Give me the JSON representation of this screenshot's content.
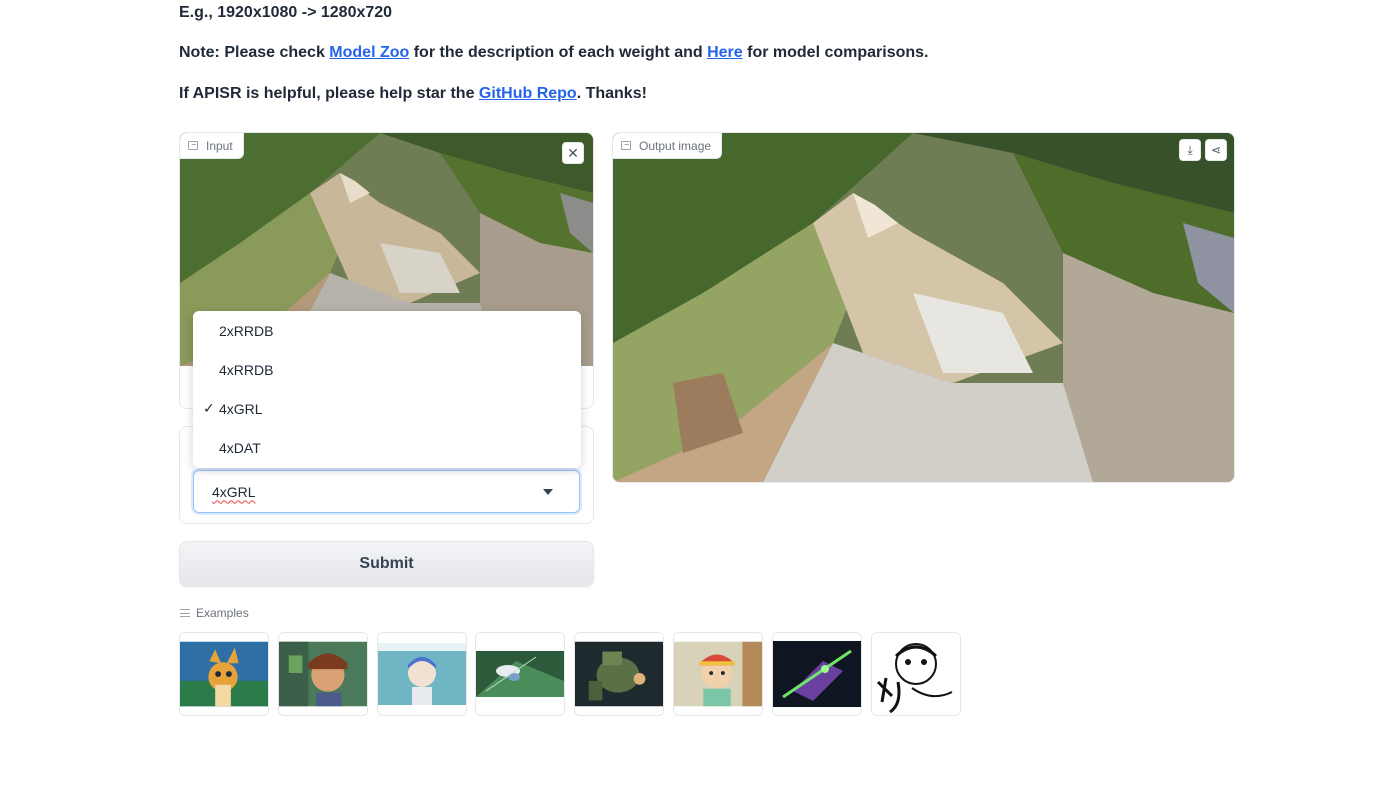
{
  "intro": {
    "line1": "E.g., 1920x1080 -> 1280x720",
    "line2_pre": "Note: Please check ",
    "line2_link1": "Model Zoo",
    "line2_mid": " for the description of each weight and ",
    "line2_link2": "Here",
    "line2_post": " for model comparisons.",
    "line3_pre": "If APISR is helpful, please help star the ",
    "line3_link": "GitHub Repo",
    "line3_post": ". Thanks!"
  },
  "input_panel": {
    "label": "Input",
    "clear_icon": "close-icon"
  },
  "output_panel": {
    "label": "Output image",
    "download_icon": "download-icon",
    "share_icon": "share-icon"
  },
  "model_select": {
    "value": "4xGRL",
    "options": [
      {
        "label": "2xRRDB",
        "selected": false
      },
      {
        "label": "4xRRDB",
        "selected": false
      },
      {
        "label": "4xGRL",
        "selected": true
      },
      {
        "label": "4xDAT",
        "selected": false
      }
    ],
    "check_mark": "✓"
  },
  "submit": {
    "label": "Submit"
  },
  "examples": {
    "label": "Examples",
    "count": 8
  },
  "colors": {
    "link": "#2563eb",
    "focus_border": "#93c5fd"
  }
}
